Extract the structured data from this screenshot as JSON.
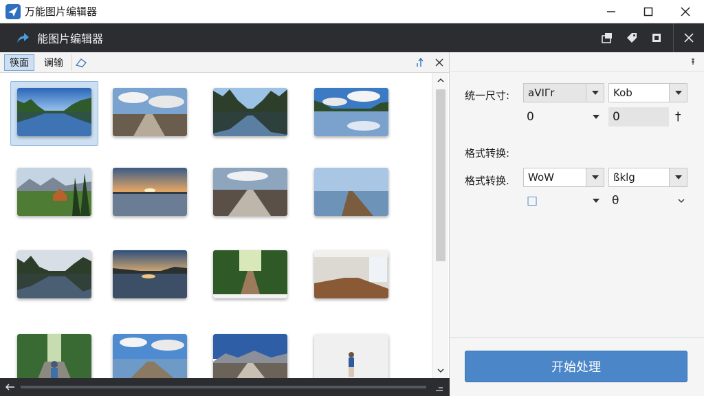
{
  "window": {
    "title": "万能图片编辑器",
    "icon": "app-plane-icon"
  },
  "toolbar": {
    "title": "能图片编辑器"
  },
  "left": {
    "tabs": [
      {
        "label": "筷面",
        "active": true
      },
      {
        "label": "谰输",
        "active": false
      }
    ]
  },
  "right": {
    "row1_label": "统一尺寸:",
    "row1_dd1": "aVIΓr",
    "row1_dd2": "Kob",
    "row1_val1": "0",
    "row1_val2": "0",
    "row1_suffix": "†",
    "section_label": "格式转换:",
    "row2_label": "格式转换.",
    "row2_dd1": "WoW",
    "row2_dd2": "ßklg",
    "row2_val1": "□",
    "row2_val2": "θ",
    "start_button": "开始处理"
  },
  "colors": {
    "accent": "#4a86c8",
    "toolbar_bg": "#2b2d31",
    "selection": "#cde0f3"
  }
}
